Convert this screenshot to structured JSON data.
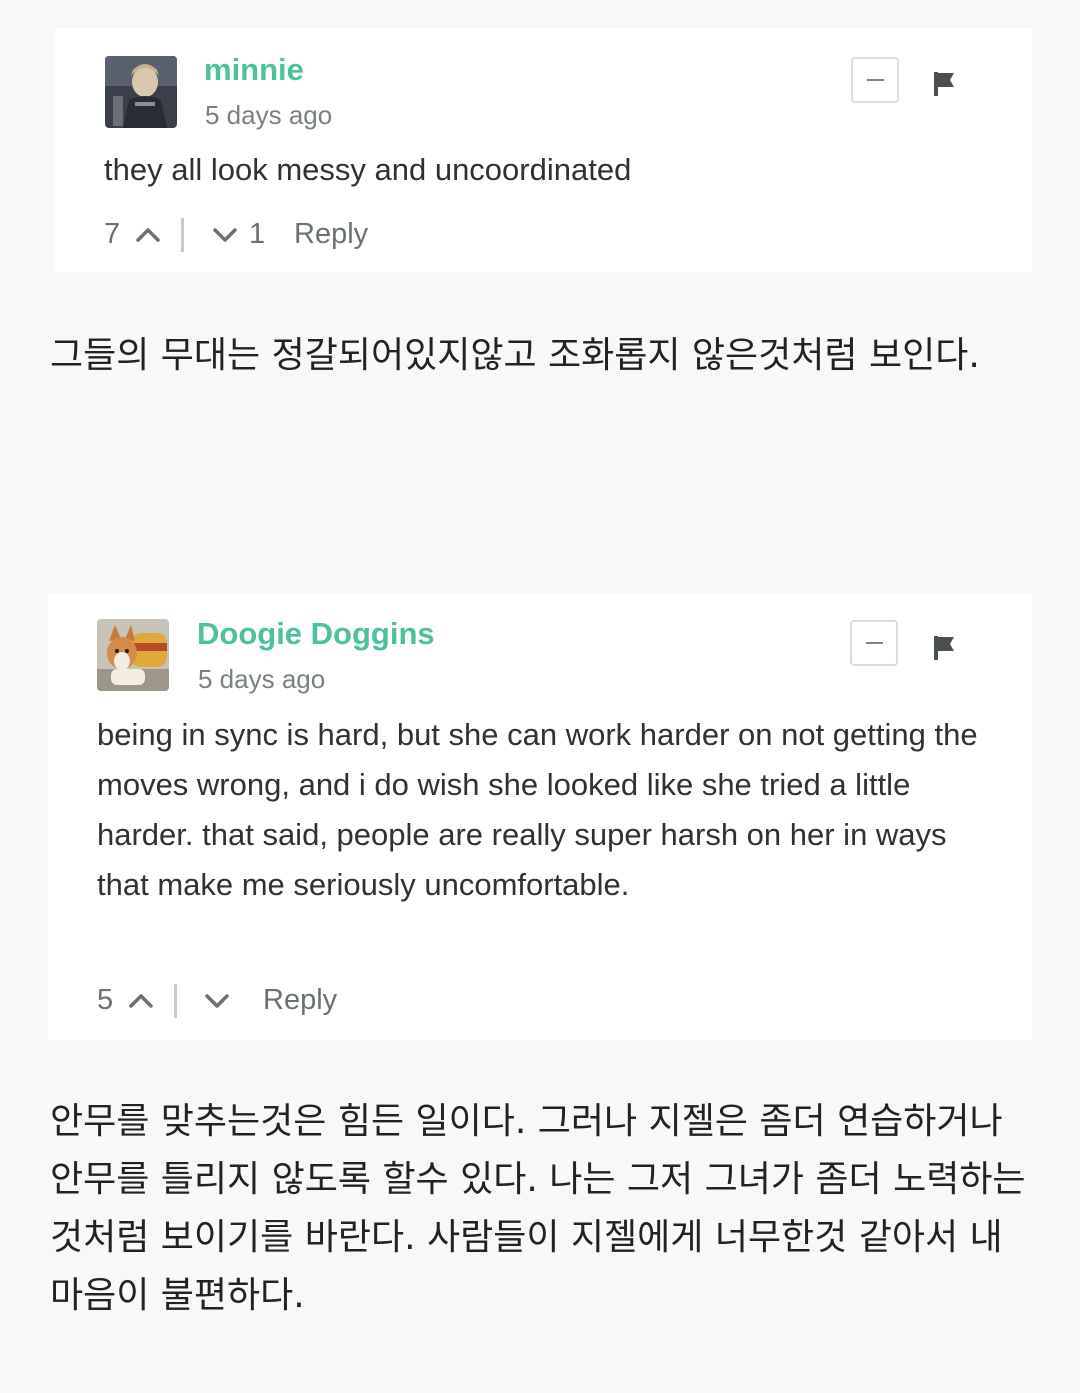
{
  "comments": [
    {
      "author": "minnie",
      "timestamp": "5 days ago",
      "text": "they all look messy and uncoordinated",
      "upvotes": "7",
      "downvotes": "1",
      "reply_label": "Reply",
      "avatar_icon": "anime-character-avatar"
    },
    {
      "author": "Doogie Doggins",
      "timestamp": "5 days ago",
      "text": "being in sync is hard, but she can work harder on not getting the moves wrong, and i do wish she looked like she tried a little harder. that said, people are really super harsh on her in ways that make me seriously uncomfortable.",
      "upvotes": "5",
      "downvotes": "",
      "reply_label": "Reply",
      "avatar_icon": "corgi-dog-avatar"
    }
  ],
  "translations": [
    "그들의 무대는 정갈되어있지않고 조화롭지 않은것처럼 보인다.",
    "안무를 맞추는것은 힘든 일이다. 그러나 지젤은 좀더 연습하거나 안무를 틀리지 않도록 할수 있다. 나는 그저 그녀가 좀더 노력하는것처럼 보이기를 바란다. 사람들이 지젤에게 너무한것 같아서 내 마음이 불편하다."
  ],
  "colors": {
    "author": "#4cc19a",
    "background": "#f8f8f8",
    "card": "#ffffff",
    "muted": "#7a8183"
  }
}
